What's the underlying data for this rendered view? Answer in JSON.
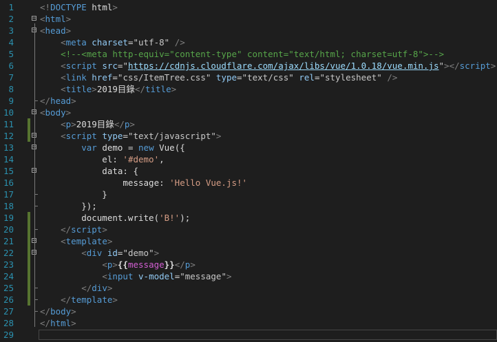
{
  "editor": {
    "language": "html",
    "lines": [
      {
        "n": "1",
        "fold": "",
        "changed": false,
        "tokens": [
          [
            "dc",
            "<!"
          ],
          [
            "tg",
            "DOCTYPE"
          ],
          [
            "tx",
            " html"
          ],
          [
            "dc",
            ">"
          ]
        ]
      },
      {
        "n": "2",
        "fold": "−",
        "changed": false,
        "tokens": [
          [
            "dc",
            "<"
          ],
          [
            "tg",
            "html"
          ],
          [
            "dc",
            ">"
          ]
        ]
      },
      {
        "n": "3",
        "fold": "−",
        "changed": false,
        "tokens": [
          [
            "dc",
            "<"
          ],
          [
            "tg",
            "head"
          ],
          [
            "dc",
            ">"
          ]
        ]
      },
      {
        "n": "4",
        "fold": "",
        "changed": false,
        "tokens": [
          [
            "tx",
            "    "
          ],
          [
            "dc",
            "<"
          ],
          [
            "tg",
            "meta"
          ],
          [
            "tx",
            " "
          ],
          [
            "at",
            "charset"
          ],
          [
            "pu",
            "="
          ],
          [
            "av",
            "\"utf-8\""
          ],
          [
            "tx",
            " "
          ],
          [
            "dc",
            "/>"
          ]
        ]
      },
      {
        "n": "5",
        "fold": "",
        "changed": false,
        "tokens": [
          [
            "tx",
            "    "
          ],
          [
            "cm",
            "<!--<meta http-equiv=\"content-type\" content=\"text/html; charset=utf-8\">-->"
          ]
        ]
      },
      {
        "n": "6",
        "fold": "",
        "changed": false,
        "tokens": [
          [
            "tx",
            "    "
          ],
          [
            "dc",
            "<"
          ],
          [
            "tg",
            "script"
          ],
          [
            "tx",
            " "
          ],
          [
            "at",
            "src"
          ],
          [
            "pu",
            "="
          ],
          [
            "av",
            "\""
          ],
          [
            "ur",
            "https://cdnjs.cloudflare.com/ajax/libs/vue/1.0.18/vue.min.js"
          ],
          [
            "av",
            "\""
          ],
          [
            "dc",
            "></"
          ],
          [
            "tg",
            "script"
          ],
          [
            "dc",
            ">"
          ]
        ]
      },
      {
        "n": "7",
        "fold": "",
        "changed": false,
        "tokens": [
          [
            "tx",
            "    "
          ],
          [
            "dc",
            "<"
          ],
          [
            "tg",
            "link"
          ],
          [
            "tx",
            " "
          ],
          [
            "at",
            "href"
          ],
          [
            "pu",
            "="
          ],
          [
            "av",
            "\"css/ItemTree.css\""
          ],
          [
            "tx",
            " "
          ],
          [
            "at",
            "type"
          ],
          [
            "pu",
            "="
          ],
          [
            "av",
            "\"text/css\""
          ],
          [
            "tx",
            " "
          ],
          [
            "at",
            "rel"
          ],
          [
            "pu",
            "="
          ],
          [
            "av",
            "\"stylesheet\""
          ],
          [
            "tx",
            " "
          ],
          [
            "dc",
            "/>"
          ]
        ]
      },
      {
        "n": "8",
        "fold": "",
        "changed": false,
        "tokens": [
          [
            "tx",
            "    "
          ],
          [
            "dc",
            "<"
          ],
          [
            "tg",
            "title"
          ],
          [
            "dc",
            ">"
          ],
          [
            "tx",
            "2019目錄"
          ],
          [
            "dc",
            "</"
          ],
          [
            "tg",
            "title"
          ],
          [
            "dc",
            ">"
          ]
        ]
      },
      {
        "n": "9",
        "fold": "",
        "changed": false,
        "tokens": [
          [
            "dc",
            "</"
          ],
          [
            "tg",
            "head"
          ],
          [
            "dc",
            ">"
          ]
        ]
      },
      {
        "n": "10",
        "fold": "−",
        "changed": false,
        "tokens": [
          [
            "dc",
            "<"
          ],
          [
            "tg",
            "body"
          ],
          [
            "dc",
            ">"
          ]
        ]
      },
      {
        "n": "11",
        "fold": "",
        "changed": true,
        "tokens": [
          [
            "tx",
            "    "
          ],
          [
            "dc",
            "<"
          ],
          [
            "tg",
            "p"
          ],
          [
            "dc",
            ">"
          ],
          [
            "tx",
            "2019目錄"
          ],
          [
            "dc",
            "</"
          ],
          [
            "tg",
            "p"
          ],
          [
            "dc",
            ">"
          ]
        ]
      },
      {
        "n": "12",
        "fold": "−",
        "changed": true,
        "tokens": [
          [
            "tx",
            "    "
          ],
          [
            "dc",
            "<"
          ],
          [
            "tg",
            "script"
          ],
          [
            "tx",
            " "
          ],
          [
            "at",
            "type"
          ],
          [
            "pu",
            "="
          ],
          [
            "av",
            "\"text/javascript\""
          ],
          [
            "dc",
            ">"
          ]
        ]
      },
      {
        "n": "13",
        "fold": "−",
        "changed": false,
        "tokens": [
          [
            "tx",
            "        "
          ],
          [
            "kw",
            "var"
          ],
          [
            "tx",
            " demo = "
          ],
          [
            "kw",
            "new"
          ],
          [
            "tx",
            " Vue({"
          ]
        ]
      },
      {
        "n": "14",
        "fold": "",
        "changed": false,
        "tokens": [
          [
            "tx",
            "            el: "
          ],
          [
            "st",
            "'#demo'"
          ],
          [
            "tx",
            ","
          ]
        ]
      },
      {
        "n": "15",
        "fold": "−",
        "changed": false,
        "tokens": [
          [
            "tx",
            "            data: {"
          ]
        ]
      },
      {
        "n": "16",
        "fold": "",
        "changed": false,
        "tokens": [
          [
            "tx",
            "                message: "
          ],
          [
            "st",
            "'Hello Vue.js!'"
          ]
        ]
      },
      {
        "n": "17",
        "fold": "",
        "changed": false,
        "tokens": [
          [
            "tx",
            "            }"
          ]
        ]
      },
      {
        "n": "18",
        "fold": "",
        "changed": false,
        "tokens": [
          [
            "tx",
            "        });"
          ]
        ]
      },
      {
        "n": "19",
        "fold": "",
        "changed": true,
        "tokens": [
          [
            "tx",
            "        document.write("
          ],
          [
            "st",
            "'B!'"
          ],
          [
            "tx",
            ");"
          ]
        ]
      },
      {
        "n": "20",
        "fold": "",
        "changed": true,
        "tokens": [
          [
            "tx",
            "    "
          ],
          [
            "dc",
            "</"
          ],
          [
            "tg",
            "script"
          ],
          [
            "dc",
            ">"
          ]
        ]
      },
      {
        "n": "21",
        "fold": "−",
        "changed": true,
        "tokens": [
          [
            "tx",
            "    "
          ],
          [
            "dc",
            "<"
          ],
          [
            "tg",
            "template"
          ],
          [
            "dc",
            ">"
          ]
        ]
      },
      {
        "n": "22",
        "fold": "−",
        "changed": true,
        "tokens": [
          [
            "tx",
            "        "
          ],
          [
            "dc",
            "<"
          ],
          [
            "tg",
            "div"
          ],
          [
            "tx",
            " "
          ],
          [
            "at",
            "id"
          ],
          [
            "pu",
            "="
          ],
          [
            "av",
            "\"demo\""
          ],
          [
            "dc",
            ">"
          ]
        ]
      },
      {
        "n": "23",
        "fold": "",
        "changed": true,
        "tokens": [
          [
            "tx",
            "            "
          ],
          [
            "dc",
            "<"
          ],
          [
            "tg",
            "p"
          ],
          [
            "dc",
            ">"
          ],
          [
            "mu",
            "{{"
          ],
          [
            "mv",
            "message"
          ],
          [
            "mu",
            "}}"
          ],
          [
            "dc",
            "</"
          ],
          [
            "tg",
            "p"
          ],
          [
            "dc",
            ">"
          ]
        ]
      },
      {
        "n": "24",
        "fold": "",
        "changed": true,
        "tokens": [
          [
            "tx",
            "            "
          ],
          [
            "dc",
            "<"
          ],
          [
            "tg",
            "input"
          ],
          [
            "tx",
            " "
          ],
          [
            "at",
            "v-model"
          ],
          [
            "pu",
            "="
          ],
          [
            "av",
            "\"message\""
          ],
          [
            "dc",
            ">"
          ]
        ]
      },
      {
        "n": "25",
        "fold": "",
        "changed": true,
        "tokens": [
          [
            "tx",
            "        "
          ],
          [
            "dc",
            "</"
          ],
          [
            "tg",
            "div"
          ],
          [
            "dc",
            ">"
          ]
        ]
      },
      {
        "n": "26",
        "fold": "",
        "changed": true,
        "tokens": [
          [
            "tx",
            "    "
          ],
          [
            "dc",
            "</"
          ],
          [
            "tg",
            "template"
          ],
          [
            "dc",
            ">"
          ]
        ]
      },
      {
        "n": "27",
        "fold": "",
        "changed": false,
        "tokens": [
          [
            "dc",
            "</"
          ],
          [
            "tg",
            "body"
          ],
          [
            "dc",
            ">"
          ]
        ]
      },
      {
        "n": "28",
        "fold": "",
        "changed": false,
        "tokens": [
          [
            "dc",
            "</"
          ],
          [
            "tg",
            "html"
          ],
          [
            "dc",
            ">"
          ]
        ]
      },
      {
        "n": "29",
        "fold": "",
        "changed": false,
        "tokens": []
      }
    ]
  },
  "colors": {
    "background": "#1e1e1e",
    "line_number": "#2b91af",
    "change_bar": "#577430",
    "tag": "#569cd6",
    "attribute": "#92caf4",
    "string": "#d69d85",
    "comment": "#57a64a",
    "mustache_var": "#d25fd2"
  }
}
